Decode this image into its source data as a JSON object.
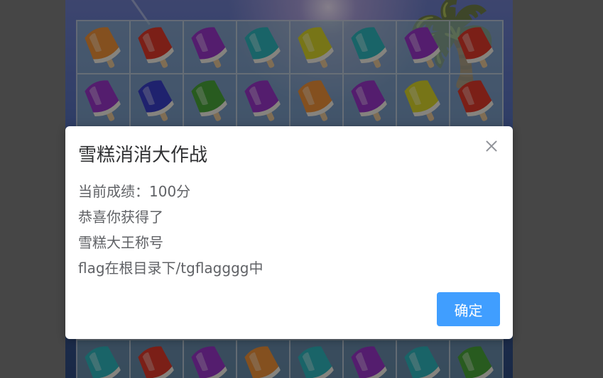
{
  "dialog": {
    "title": "雪糕消消大作战",
    "lines": [
      "当前成绩：100分",
      "恭喜你获得了",
      "雪糕大王称号",
      "flag在根目录下/tgflagggg中"
    ],
    "confirm_label": "确定",
    "close_icon": "close-icon"
  },
  "board": {
    "top_rows": [
      [
        "orange",
        "red",
        "purple",
        "teal",
        "yellow",
        "teal",
        "purple",
        "red"
      ],
      [
        "purple",
        "blue",
        "green",
        "purple",
        "orange",
        "purple",
        "yellow",
        "red"
      ]
    ],
    "bottom_row": [
      "teal",
      "red",
      "purple",
      "orange",
      "teal",
      "purple",
      "teal",
      "green"
    ]
  },
  "colors": {
    "orange": "#f0923a",
    "red": "#e0392a",
    "purple": "#9a35c9",
    "teal": "#2fb7bd",
    "yellow": "#d9d52a",
    "blue": "#3a3fc9",
    "green": "#4aa63a",
    "accent": "#409eff"
  }
}
